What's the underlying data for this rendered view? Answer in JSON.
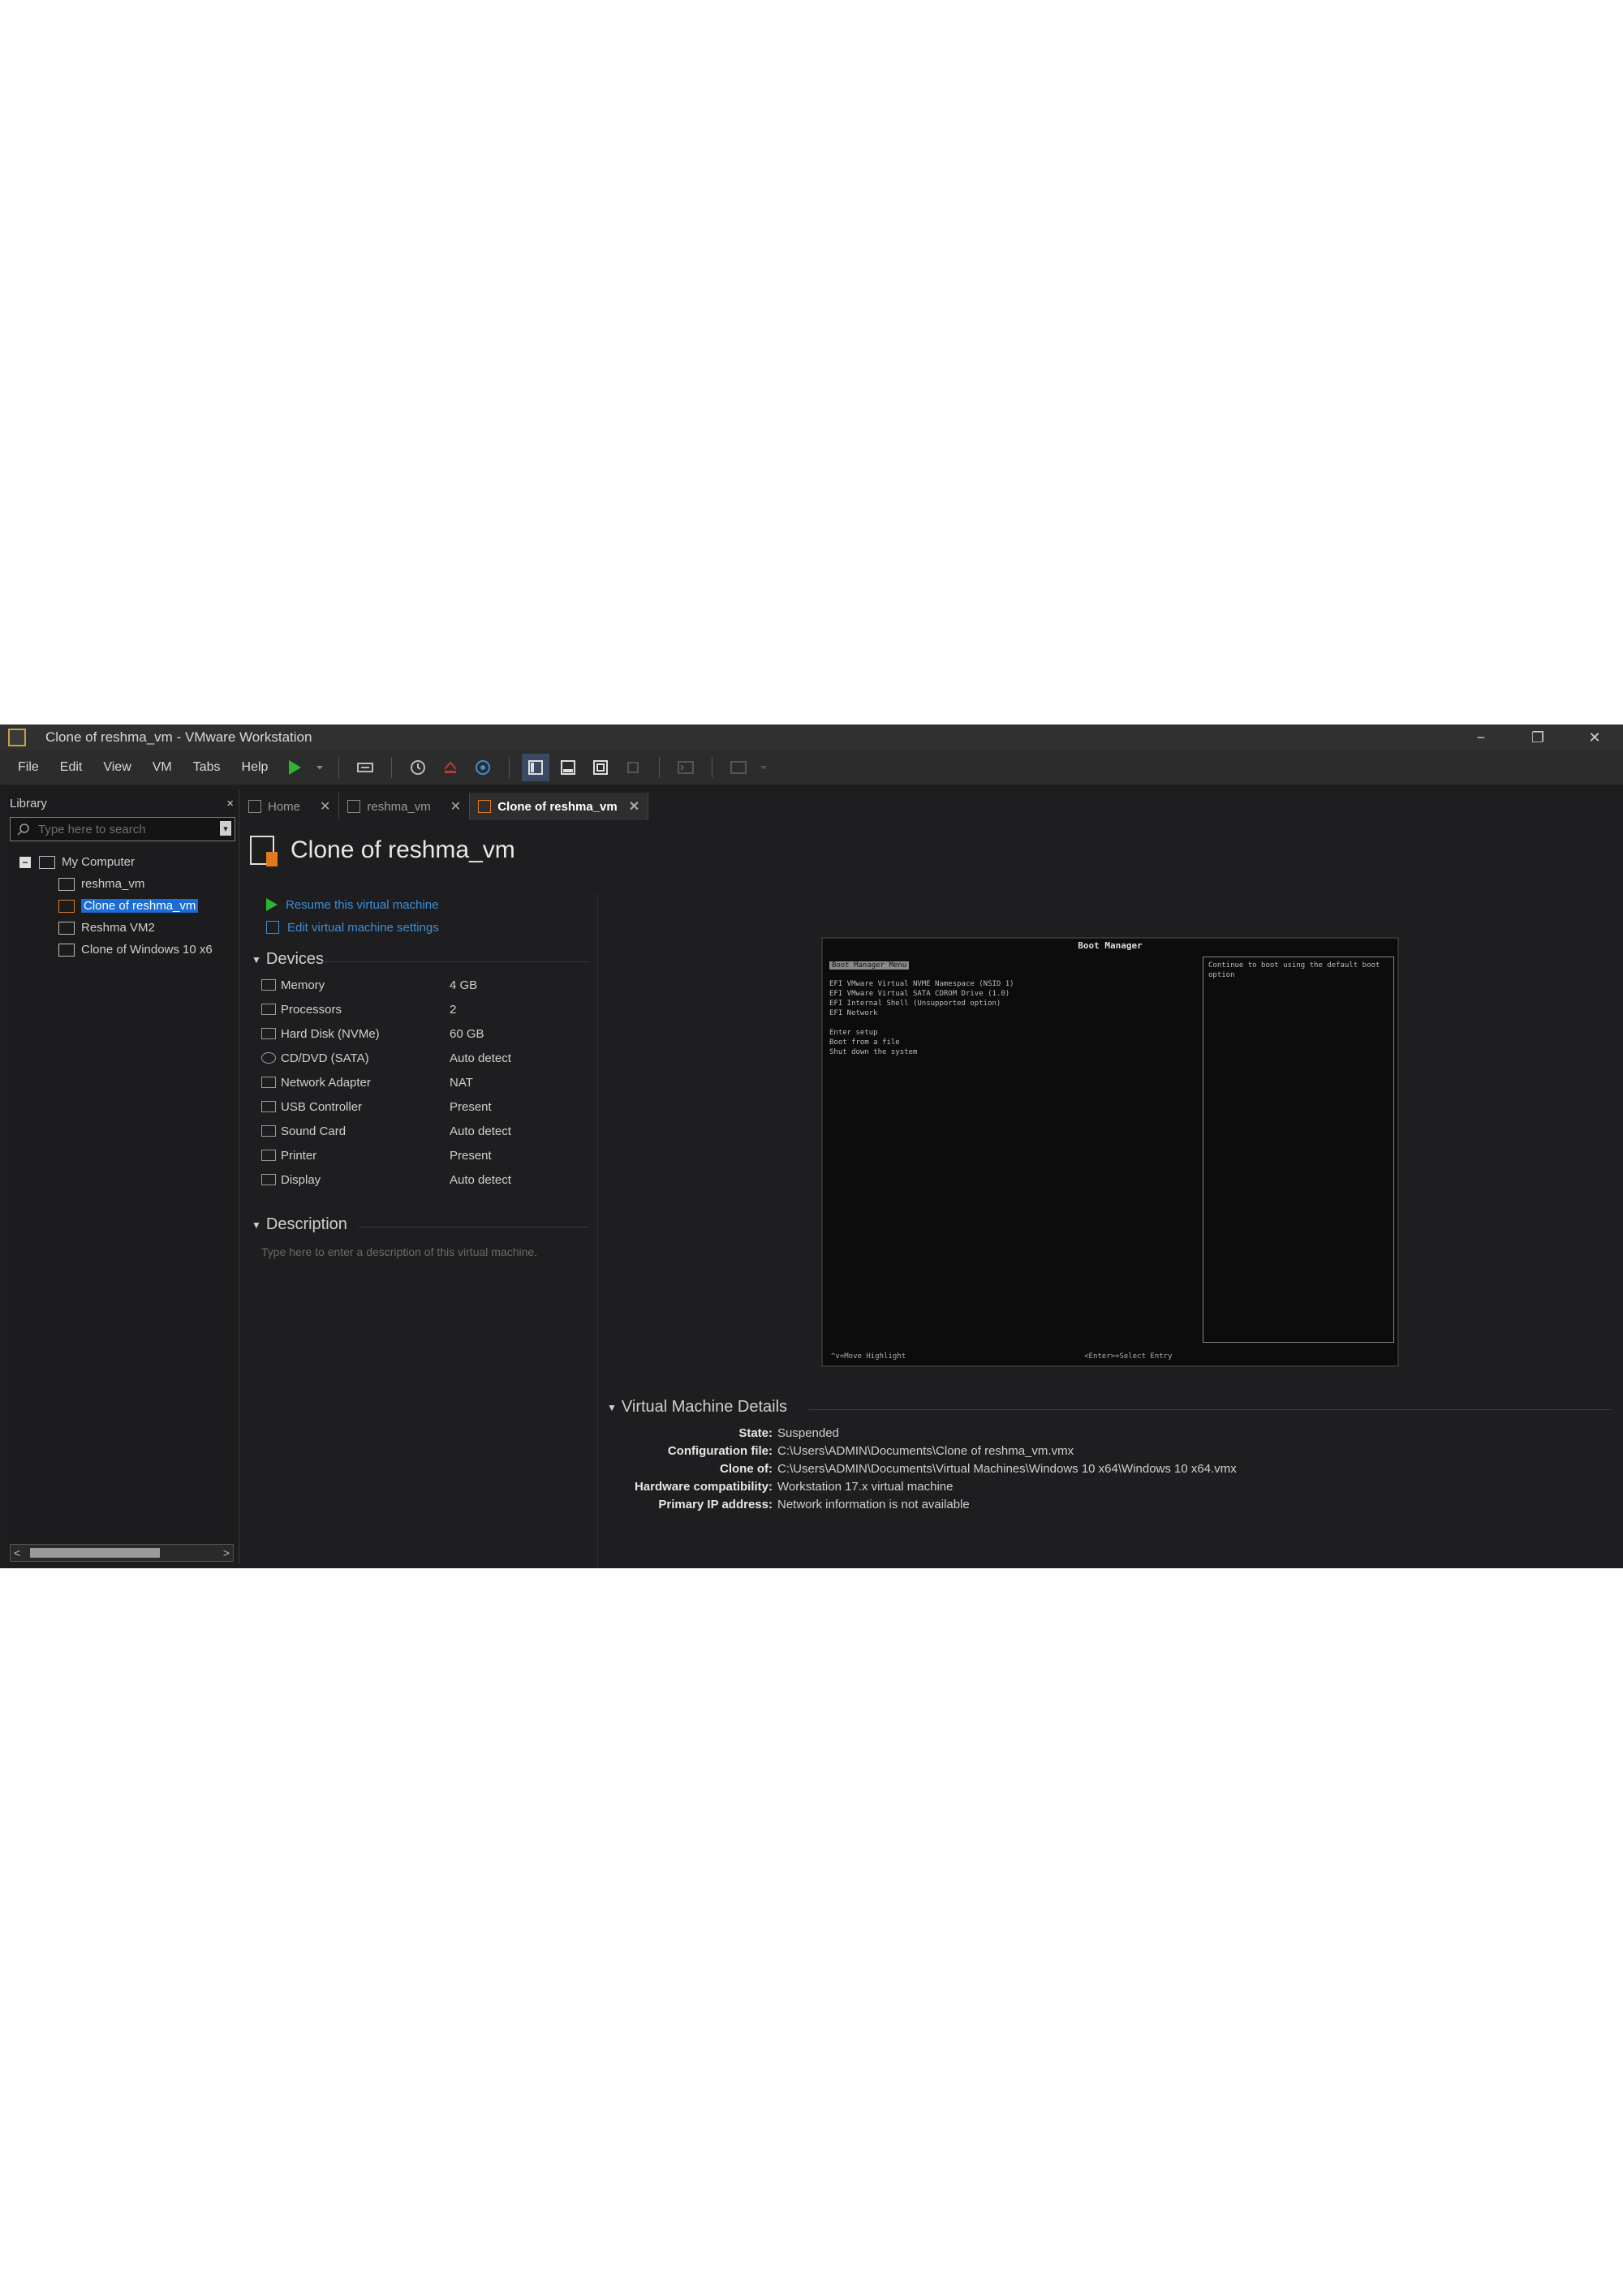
{
  "window": {
    "title": "Clone of reshma_vm - VMware Workstation",
    "controls": [
      "−",
      "❐",
      "✕"
    ]
  },
  "menu": [
    "File",
    "Edit",
    "View",
    "VM",
    "Tabs",
    "Help"
  ],
  "library": {
    "title": "Library",
    "close": "×",
    "search_placeholder": "Type here to search",
    "root": "My Computer",
    "items": [
      "reshma_vm",
      "Clone of reshma_vm",
      "Reshma VM2",
      "Clone of Windows 10 x6"
    ],
    "selected_index": 1,
    "scroll_left": "<",
    "scroll_right": ">"
  },
  "tabs": [
    {
      "label": "Home",
      "close": "✕"
    },
    {
      "label": "reshma_vm",
      "close": "✕"
    },
    {
      "label": "Clone of reshma_vm",
      "close": "✕"
    }
  ],
  "vm": {
    "name": "Clone of reshma_vm",
    "actions": [
      "Resume this virtual machine",
      "Edit virtual machine settings"
    ]
  },
  "devices": {
    "heading": "Devices",
    "rows": [
      {
        "name": "Memory",
        "value": "4 GB"
      },
      {
        "name": "Processors",
        "value": "2"
      },
      {
        "name": "Hard Disk (NVMe)",
        "value": "60 GB"
      },
      {
        "name": "CD/DVD (SATA)",
        "value": "Auto detect"
      },
      {
        "name": "Network Adapter",
        "value": "NAT"
      },
      {
        "name": "USB Controller",
        "value": "Present"
      },
      {
        "name": "Sound Card",
        "value": "Auto detect"
      },
      {
        "name": "Printer",
        "value": "Present"
      },
      {
        "name": "Display",
        "value": "Auto detect"
      }
    ]
  },
  "description": {
    "heading": "Description",
    "placeholder": "Type here to enter a description of this virtual machine."
  },
  "console": {
    "title": "Boot Manager",
    "highlight": "Boot Manager Menu",
    "lines": [
      "EFI VMware Virtual NVME Namespace (NSID 1)",
      "EFI VMware Virtual SATA CDROM Drive (1.0)",
      "EFI Internal Shell (Unsupported option)",
      "EFI Network",
      "",
      "Enter setup",
      "Boot from a file",
      "Shut down the system"
    ],
    "right_text": "Continue to boot using the default boot option",
    "footer_left": "^v=Move Highlight",
    "footer_right": "<Enter>=Select Entry"
  },
  "details": {
    "heading": "Virtual Machine Details",
    "rows": [
      {
        "key": "State:",
        "value": "Suspended"
      },
      {
        "key": "Configuration file:",
        "value": "C:\\Users\\ADMIN\\Documents\\Clone of reshma_vm.vmx"
      },
      {
        "key": "Clone of:",
        "value": "C:\\Users\\ADMIN\\Documents\\Virtual Machines\\Windows 10 x64\\Windows 10 x64.vmx"
      },
      {
        "key": "Hardware compatibility:",
        "value": "Workstation 17.x virtual machine"
      },
      {
        "key": "Primary IP address:",
        "value": "Network information is not available"
      }
    ]
  }
}
